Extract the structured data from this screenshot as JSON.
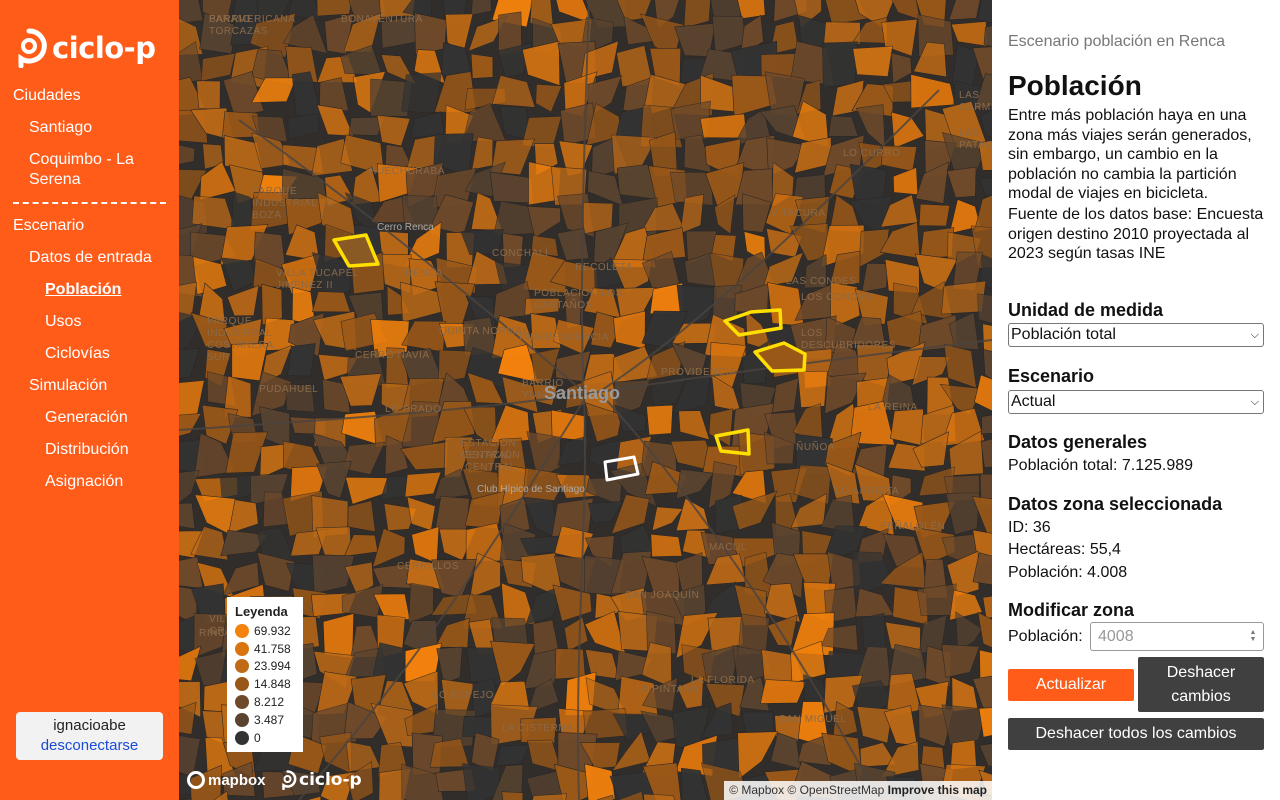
{
  "app": {
    "brand": "ciclo-p"
  },
  "sidebar": {
    "cities_heading": "Ciudades",
    "cities": [
      "Santiago",
      "Coquimbo - La Serena"
    ],
    "scenario_heading": "Escenario",
    "input_heading": "Datos de entrada",
    "input_items": [
      "Población",
      "Usos",
      "Ciclovías"
    ],
    "active_item": "Población",
    "simulation_heading": "Simulación",
    "simulation_items": [
      "Generación",
      "Distribución",
      "Asignación"
    ],
    "user": {
      "name": "ignacioabe",
      "logout": "desconectarse"
    }
  },
  "map": {
    "city_label": "Santiago",
    "place_labels": [
      "BARRIO TORCAZAS",
      "HUECHURABA",
      "VITACURA",
      "LO CURRO",
      "RENCA",
      "CONCHALÍ",
      "RECOLETA",
      "QUINTA NORMAL",
      "INDEPENDENCIA",
      "PROVIDENCIA",
      "LA REINA",
      "CERRO NAVIA",
      "LO PRADO",
      "PUDAHUEL",
      "ESTACIÓN CENTRAL",
      "ÑUÑOA",
      "MACUL",
      "PEÑALOLÉN",
      "SAN JOAQUÍN",
      "CERRILLOS",
      "LO ESPEJO",
      "LA CISTERNA",
      "LA FLORIDA",
      "LOS CONDES",
      "LAS CONDES",
      "LA PINTANA",
      "SAN MIGUEL",
      "BONAVENTURA",
      "VILLA TUCAPEL JIMÉNEZ II",
      "POBLACIÓN LOS CASTAÑOS",
      "PARQUE INDUSTRIAL LO BOZA",
      "PARQUE INDUSTRIAL COSTANERA SUR",
      "LO ARRIETA",
      "BARRIO YUNGAY",
      "LOS DESCUBRIDORES",
      "PANAMERICANA",
      "LAS CARMELITAS",
      "LAS PATAGUAS",
      "VILLA LAS GRANJAS",
      "ESTACIÓN CENTRAL",
      "RINCONADA"
    ],
    "small_labels": [
      "Cerro Renca",
      "Club Hípico de Santiago"
    ],
    "legend": {
      "title": "Leyenda",
      "items": [
        {
          "value": "69.932",
          "color": "#f4820c"
        },
        {
          "value": "41.758",
          "color": "#d9740f"
        },
        {
          "value": "23.994",
          "color": "#be6a16"
        },
        {
          "value": "14.848",
          "color": "#9a5818"
        },
        {
          "value": "8.212",
          "color": "#6f4a2a"
        },
        {
          "value": "3.487",
          "color": "#5a4430"
        },
        {
          "value": "0",
          "color": "#333333"
        }
      ]
    },
    "mapbox_label": "mapbox",
    "attribution": "© Mapbox © OpenStreetMap",
    "improve": "Improve this map"
  },
  "panel": {
    "scenario_title": "Escenario población en Renca",
    "title": "Población",
    "description": "Entre más población haya en una zona más viajes serán generados, sin embargo, un cambio en la población no cambia la partición modal de viajes en bicicleta.",
    "source": "Fuente de los datos base: Encuesta origen destino 2010 proyectada al 2023 según tasas INE",
    "unit_heading": "Unidad de medida",
    "unit_value": "Población total",
    "scenario_heading": "Escenario",
    "scenario_value": "Actual",
    "general_heading": "Datos generales",
    "general_total": "Población total: 7.125.989",
    "zone_heading": "Datos zona seleccionada",
    "zone_id": "ID: 36",
    "zone_hectares": "Hectáreas: 55,4",
    "zone_population": "Población: 4.008",
    "modify_heading": "Modificar zona",
    "modify_label": "Población:",
    "modify_placeholder": "4008",
    "btn_update": "Actualizar",
    "btn_undo": "Deshacer cambios",
    "btn_undo_all": "Deshacer todos los cambios"
  }
}
